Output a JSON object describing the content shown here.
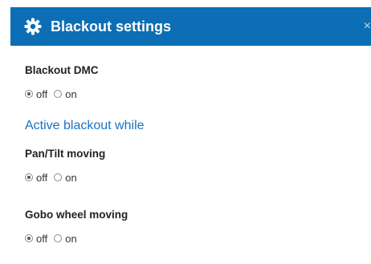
{
  "dialog": {
    "title": "Blackout settings",
    "close_label": "×",
    "accent_color": "#0c6eb4"
  },
  "blackout_dmc": {
    "label": "Blackout DMC",
    "options": [
      "off",
      "on"
    ],
    "selected": "off"
  },
  "active_blackout": {
    "heading": "Active blackout while"
  },
  "pan_tilt": {
    "label": "Pan/Tilt moving",
    "options": [
      "off",
      "on"
    ],
    "selected": "off"
  },
  "gobo_wheel": {
    "label": "Gobo wheel moving",
    "options": [
      "off",
      "on"
    ],
    "selected": "off"
  }
}
